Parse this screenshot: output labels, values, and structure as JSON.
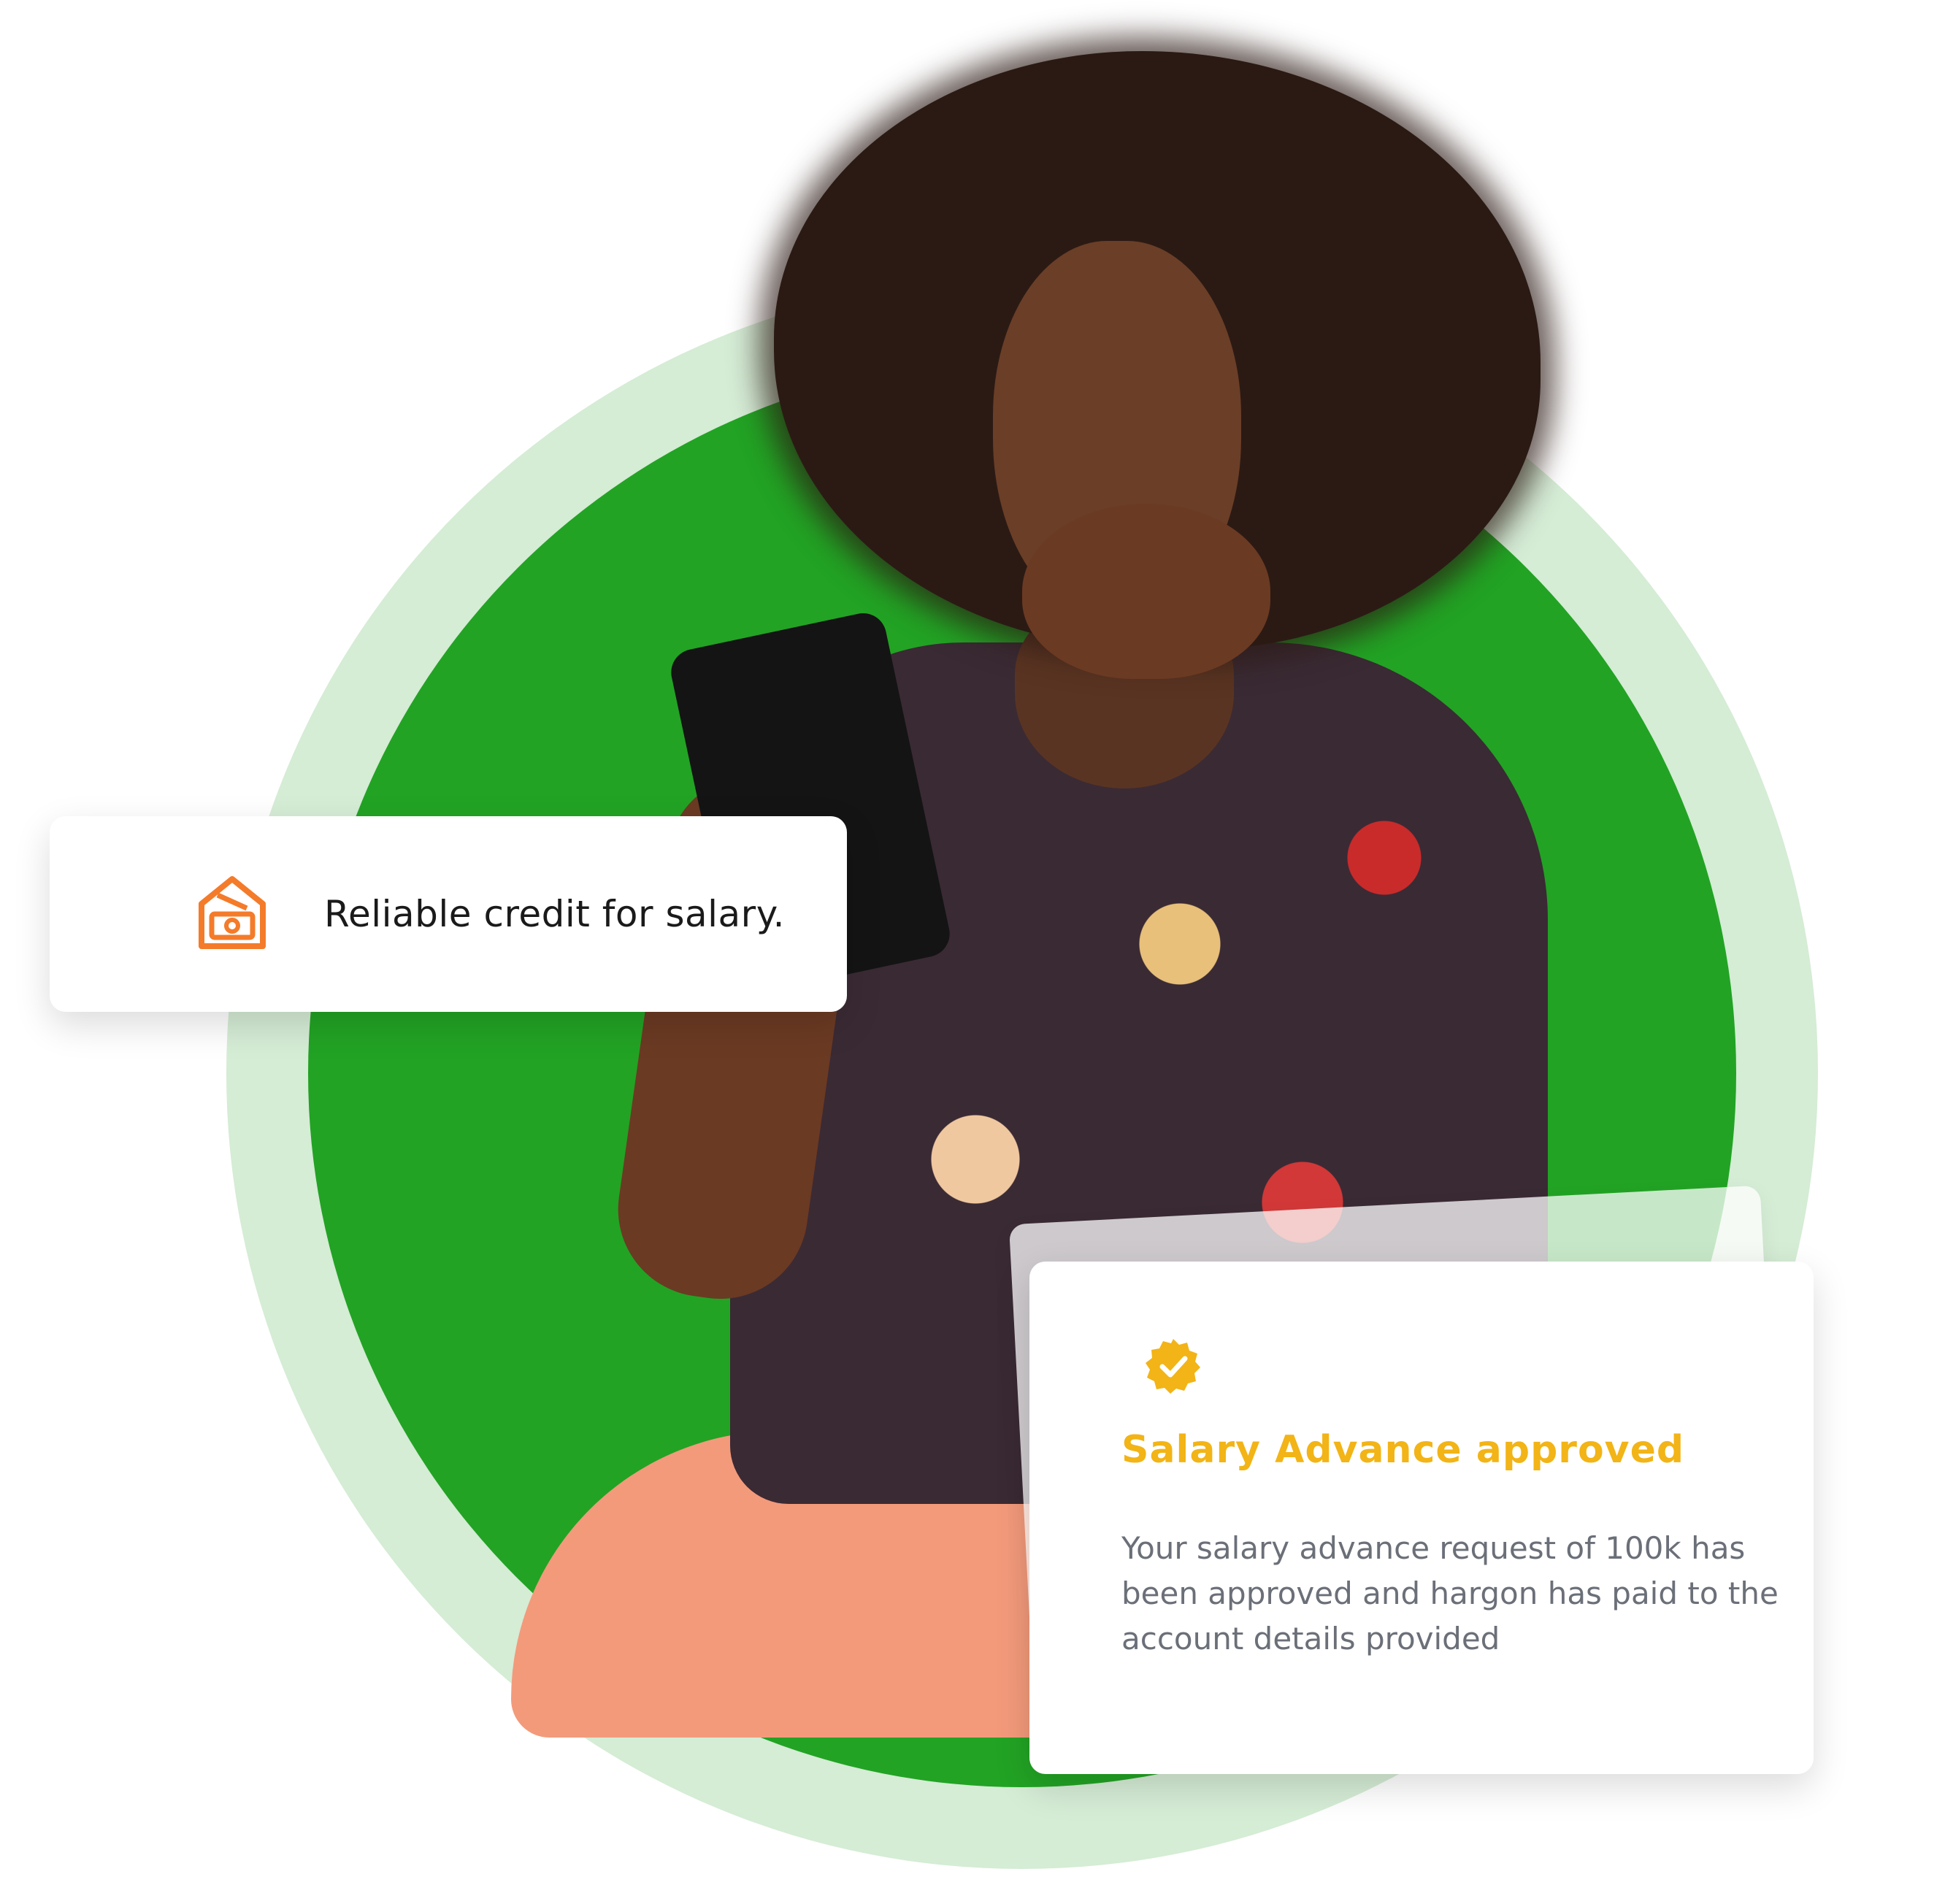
{
  "colors": {
    "ring_light": "#d5ecd5",
    "ring_green": "#22a324",
    "accent_orange": "#f47b2a",
    "accent_yellow": "#f2b416",
    "text_dark": "#1a1a1a",
    "text_muted": "#6b6f78"
  },
  "credit_card": {
    "icon": "money-house-icon",
    "label": "Reliable credit for salary."
  },
  "approval_card": {
    "icon": "verified-badge-icon",
    "title": "Salary Advance approved",
    "message": "Your salary advance request of 100k has been approved and hargon has paid to the account details provided"
  }
}
